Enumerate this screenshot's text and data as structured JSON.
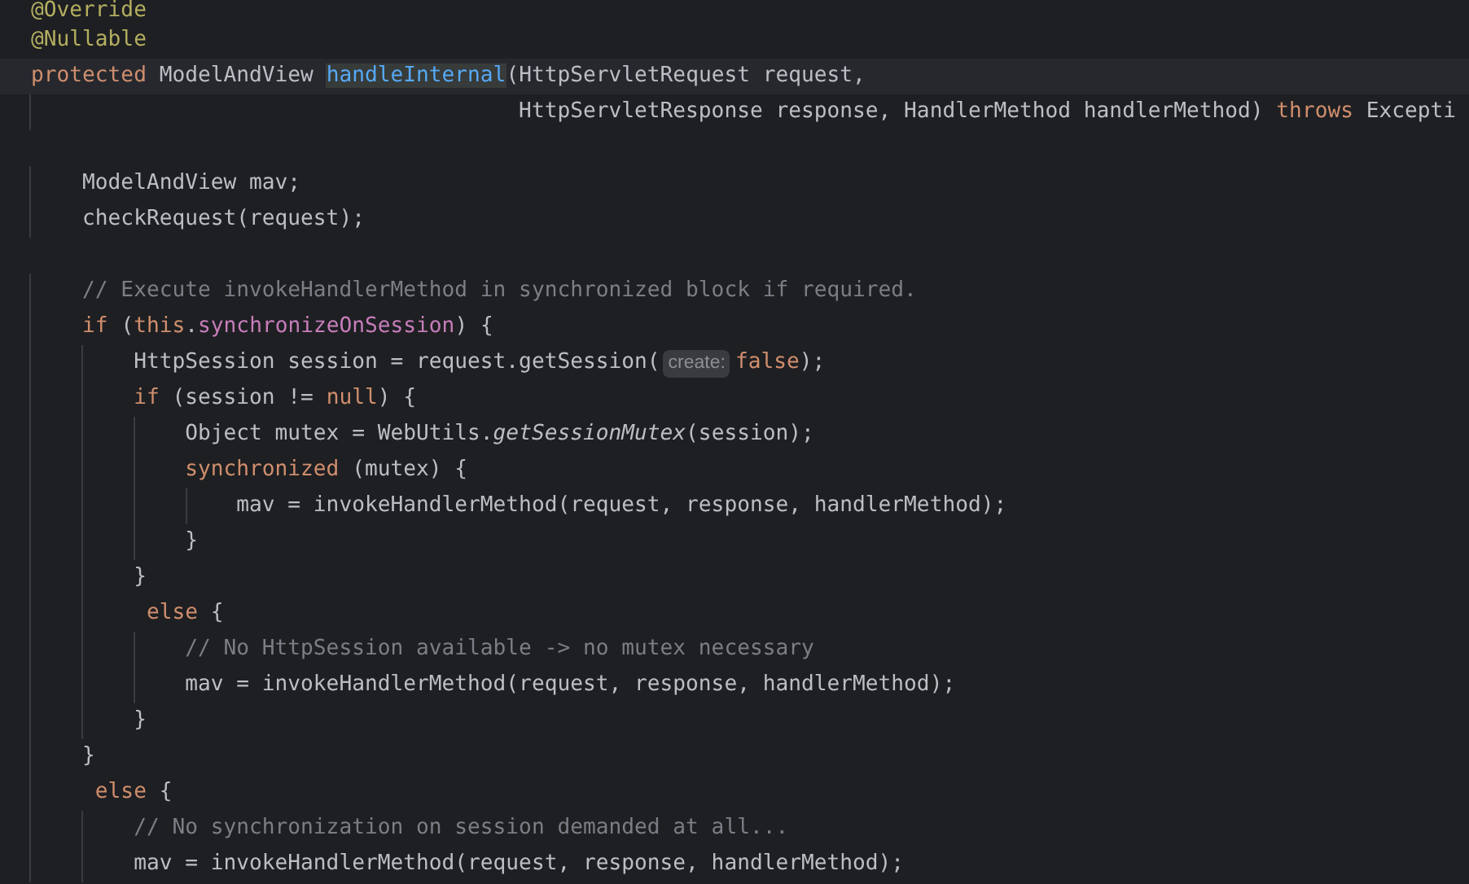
{
  "editor": {
    "lines": [
      {
        "current": false,
        "tokens": [
          {
            "text": "@Override",
            "kind": "annotation"
          }
        ]
      },
      {
        "current": false,
        "tokens": [
          {
            "text": "@Nullable",
            "kind": "annotation"
          }
        ]
      },
      {
        "current": true,
        "tokens": [
          {
            "text": "protected",
            "kind": "keyword"
          },
          {
            "text": " ModelAndView ",
            "kind": "plain"
          },
          {
            "text": "handleInternal",
            "kind": "method_declaration",
            "highlighted": true
          },
          {
            "text": "(HttpServletRequest request,",
            "kind": "plain"
          }
        ]
      },
      {
        "current": false,
        "tokens": [
          {
            "text": "                                      HttpServletResponse response, HandlerMethod handlerMethod) ",
            "kind": "plain"
          },
          {
            "text": "throws",
            "kind": "keyword"
          },
          {
            "text": " Excepti",
            "kind": "plain"
          }
        ]
      },
      {
        "current": false
      },
      {
        "current": false,
        "tokens": [
          {
            "text": "    ModelAndView mav;",
            "kind": "plain"
          }
        ]
      },
      {
        "current": false,
        "tokens": [
          {
            "text": "    checkRequest(request);",
            "kind": "plain"
          }
        ]
      },
      {
        "current": false
      },
      {
        "current": false,
        "tokens": [
          {
            "text": "    // Execute invokeHandlerMethod in synchronized block if required.",
            "kind": "comment"
          }
        ]
      },
      {
        "current": false,
        "tokens": [
          {
            "text": "    if",
            "kind": "keyword"
          },
          {
            "text": " (",
            "kind": "plain"
          },
          {
            "text": "this",
            "kind": "keyword"
          },
          {
            "text": ".",
            "kind": "plain"
          },
          {
            "text": "synchronizeOnSession",
            "kind": "field"
          },
          {
            "text": ") {",
            "kind": "plain"
          }
        ]
      },
      {
        "current": false,
        "tokens": [
          {
            "text": "        HttpSession session = request.getSession(",
            "kind": "plain"
          },
          {
            "text": "create:",
            "kind": "hint"
          },
          {
            "text": "false",
            "kind": "keyword"
          },
          {
            "text": ");",
            "kind": "plain"
          }
        ]
      },
      {
        "current": false,
        "tokens": [
          {
            "text": "        if",
            "kind": "keyword"
          },
          {
            "text": " (session != ",
            "kind": "plain"
          },
          {
            "text": "null",
            "kind": "keyword"
          },
          {
            "text": ") {",
            "kind": "plain"
          }
        ]
      },
      {
        "current": false,
        "tokens": [
          {
            "text": "            Object mutex = WebUtils.",
            "kind": "plain"
          },
          {
            "text": "getSessionMutex",
            "kind": "static_call"
          },
          {
            "text": "(session);",
            "kind": "plain"
          }
        ]
      },
      {
        "current": false,
        "tokens": [
          {
            "text": "            synchronized",
            "kind": "keyword"
          },
          {
            "text": " (mutex) {",
            "kind": "plain"
          }
        ]
      },
      {
        "current": false,
        "tokens": [
          {
            "text": "                mav = invokeHandlerMethod(request, response, handlerMethod);",
            "kind": "plain"
          }
        ]
      },
      {
        "current": false,
        "tokens": [
          {
            "text": "            }",
            "kind": "plain"
          }
        ]
      },
      {
        "current": false,
        "tokens": [
          {
            "text": "        }",
            "kind": "plain"
          }
        ]
      },
      {
        "current": false,
        "tokens": [
          {
            "text": "         else",
            "kind": "keyword"
          },
          {
            "text": " {",
            "kind": "plain"
          }
        ]
      },
      {
        "current": false,
        "tokens": [
          {
            "text": "            // No HttpSession available -> no mutex necessary",
            "kind": "comment"
          }
        ]
      },
      {
        "current": false,
        "tokens": [
          {
            "text": "            mav = invokeHandlerMethod(request, response, handlerMethod);",
            "kind": "plain"
          }
        ]
      },
      {
        "current": false,
        "tokens": [
          {
            "text": "        }",
            "kind": "plain"
          }
        ]
      },
      {
        "current": false,
        "tokens": [
          {
            "text": "    }",
            "kind": "plain"
          }
        ]
      },
      {
        "current": false,
        "tokens": [
          {
            "text": "     else",
            "kind": "keyword"
          },
          {
            "text": " {",
            "kind": "plain"
          }
        ]
      },
      {
        "current": false,
        "tokens": [
          {
            "text": "        // No synchronization on session demanded at all...",
            "kind": "comment"
          }
        ]
      },
      {
        "current": false,
        "tokens": [
          {
            "text": "        mav = invokeHandlerMethod(request, response, handlerMethod);",
            "kind": "plain"
          }
        ]
      }
    ]
  }
}
